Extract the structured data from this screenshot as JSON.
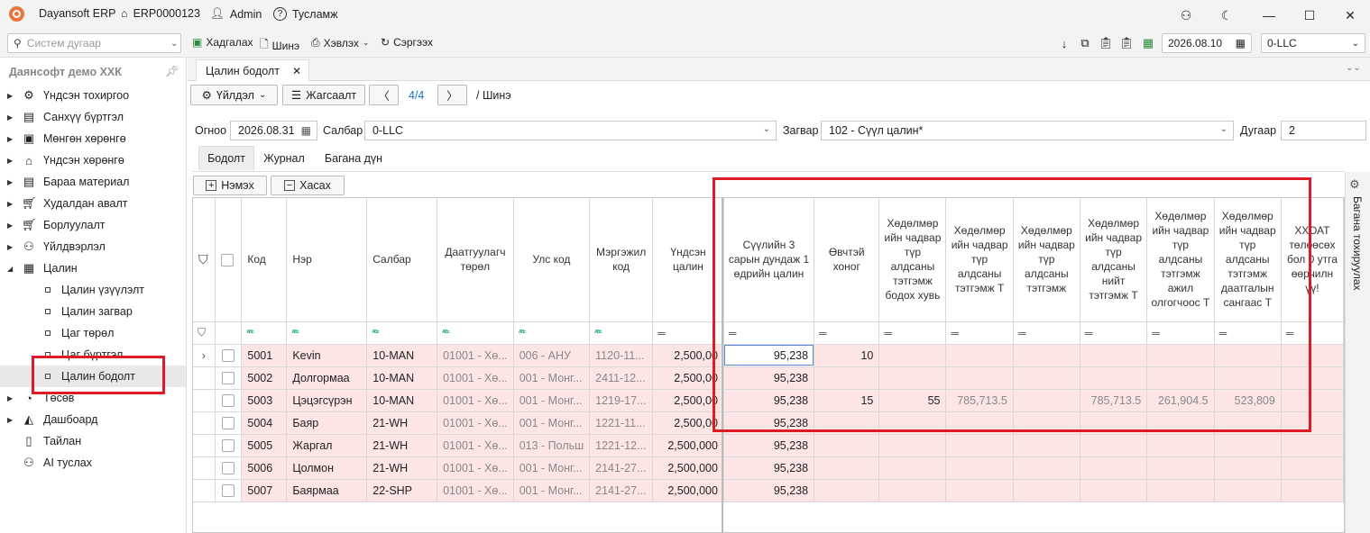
{
  "app": {
    "title": "Dayansoft ERP",
    "code": "ERP0000123",
    "user": "Admin",
    "help": "Тусламж"
  },
  "toolbar": {
    "search_placeholder": "Систем дугаар",
    "save": "Хадгалах",
    "new": "Шинэ",
    "print": "Хэвлэх",
    "refresh": "Сэргээх",
    "date": "2026.08.10",
    "branch": "0-LLC"
  },
  "sidebar": {
    "company": "Даянсофт демо ХХК",
    "items": [
      {
        "label": "Үндсэн тохиргоо",
        "icon": "gear-icon"
      },
      {
        "label": "Санхүү бүртгэл",
        "icon": "ledger-icon"
      },
      {
        "label": "Мөнгөн хөрөнгө",
        "icon": "cash-icon"
      },
      {
        "label": "Үндсэн хөрөнгө",
        "icon": "asset-icon"
      },
      {
        "label": "Бараа материал",
        "icon": "box-icon"
      },
      {
        "label": "Худалдан авалт",
        "icon": "cart-icon"
      },
      {
        "label": "Борлуулалт",
        "icon": "sales-icon"
      },
      {
        "label": "Үйлдвэрлэл",
        "icon": "factory-icon"
      },
      {
        "label": "Цалин",
        "icon": "payroll-icon"
      }
    ],
    "sub_items": [
      {
        "label": "Цалин үзүүлэлт"
      },
      {
        "label": "Цалин загвар"
      },
      {
        "label": "Цаг төрөл"
      },
      {
        "label": "Цаг бүртгэл"
      },
      {
        "label": "Цалин бодолт"
      }
    ],
    "items_after": [
      {
        "label": "Төсөв",
        "icon": "budget-icon"
      },
      {
        "label": "Дашбоард",
        "icon": "dashboard-icon"
      },
      {
        "label": "Тайлан",
        "icon": "report-icon"
      },
      {
        "label": "AI туслах",
        "icon": "ai-icon"
      }
    ]
  },
  "doc": {
    "tab": "Цалин бодолт",
    "action_btn": "Үйлдэл",
    "sort_btn": "Жагсаалт",
    "pager": "4/4",
    "status": "/ Шинэ",
    "date_label": "Огноо",
    "date": "2026.08.31",
    "branch_label": "Салбар",
    "branch": "0-LLC",
    "template_label": "Загвар",
    "template": "102 - Сүүл цалин*",
    "number_label": "Дугаар",
    "number": "2",
    "tabs": [
      "Бодолт",
      "Журнал",
      "Багана дүн"
    ],
    "add_btn": "Нэмэх",
    "remove_btn": "Хасах",
    "side_panel": "Багана тохируулах"
  },
  "grid": {
    "columns": [
      "Код",
      "Нэр",
      "Салбар",
      "Даатгуулагч төрөл",
      "Улс код",
      "Мэргэжил код",
      "Үндсэн цалин",
      "Сүүлийн 3 сарын дундаж 1 өдрийн цалин",
      "Өвчтэй хоног",
      "Хөдөлмөр ийн чадвар түр алдсаны тэтгэмж бодох хувь",
      "Хөдөлмөр ийн чадвар түр алдсаны тэтгэмж Т",
      "Хөдөлмөр ийн чадвар түр алдсаны тэтгэмж",
      "Хөдөлмөр ийн чадвар түр алдсаны нийт тэтгэмж Т",
      "Хөдөлмөр ийн чадвар түр алдсаны тэтгэмж ажил олгогчоос Т",
      "Хөдөлмөр ийн чадвар түр алдсаны тэтгэмж даатгалын сангаас Т",
      "ХХОАТ төлөөсөх бол 0 утга өөрчилн үү!"
    ],
    "rows": [
      [
        "5001",
        "Kevin",
        "10-MAN",
        "01001 - Хө...",
        "006 - АНУ",
        "1120-11...",
        "2,500,00",
        "95,238",
        "10",
        "",
        "",
        "",
        "",
        "",
        "",
        ""
      ],
      [
        "5002",
        "Долгормаа",
        "10-MAN",
        "01001 - Хө...",
        "001 - Монг...",
        "2411-12...",
        "2,500,00",
        "95,238",
        "",
        "",
        "",
        "",
        "",
        "",
        "",
        ""
      ],
      [
        "5003",
        "Цэцэгсүрэн",
        "10-MAN",
        "01001 - Хө...",
        "001 - Монг...",
        "1219-17...",
        "2,500,00",
        "95,238",
        "15",
        "55",
        "785,713.5",
        "",
        "785,713.5",
        "261,904.5",
        "523,809",
        ""
      ],
      [
        "5004",
        "Баяр",
        "21-WH",
        "01001 - Хө...",
        "001 - Монг...",
        "1221-11...",
        "2,500,00",
        "95,238",
        "",
        "",
        "",
        "",
        "",
        "",
        "",
        ""
      ],
      [
        "5005",
        "Жаргал",
        "21-WH",
        "01001 - Хө...",
        "013 - Польш",
        "1221-12...",
        "2,500,000",
        "95,238",
        "",
        "",
        "",
        "",
        "",
        "",
        "",
        ""
      ],
      [
        "5006",
        "Цолмон",
        "21-WH",
        "01001 - Хө...",
        "001 - Монг...",
        "2141-27...",
        "2,500,000",
        "95,238",
        "",
        "",
        "",
        "",
        "",
        "",
        "",
        ""
      ],
      [
        "5007",
        "Баярмаа",
        "22-SHP",
        "01001 - Хө...",
        "001 - Монг...",
        "2141-27...",
        "2,500,000",
        "95,238",
        "",
        "",
        "",
        "",
        "",
        "",
        "",
        ""
      ]
    ]
  },
  "colors": {
    "row_bg": "#fde5e5",
    "highlight": "#dd1a26"
  }
}
